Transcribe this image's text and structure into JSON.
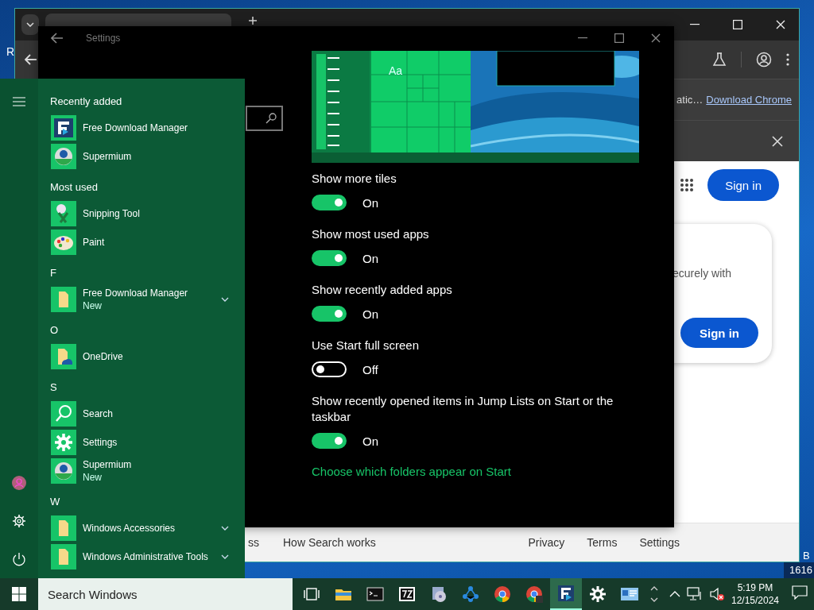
{
  "desktop": {
    "icon_label": "R",
    "corner_texts": [
      "B",
      "1616"
    ]
  },
  "browser": {
    "infobar": {
      "text": "atic…",
      "link": "Download Chrome"
    },
    "page": {
      "header_button": "Sign in",
      "card_text": "ecurely with",
      "card_button": "Sign in"
    },
    "footer": {
      "left": [
        "ss",
        "How Search works"
      ],
      "right": [
        "Privacy",
        "Terms",
        "Settings"
      ]
    }
  },
  "settings": {
    "title": "Settings",
    "preview": {
      "tile_text": "Aa"
    },
    "options": [
      {
        "label": "Show more tiles",
        "on": true,
        "state": "On"
      },
      {
        "label": "Show most used apps",
        "on": true,
        "state": "On"
      },
      {
        "label": "Show recently added apps",
        "on": true,
        "state": "On"
      },
      {
        "label": "Use Start full screen",
        "on": false,
        "state": "Off"
      },
      {
        "label": "Show recently opened items in Jump Lists on Start or the taskbar",
        "on": true,
        "state": "On"
      }
    ],
    "link": "Choose which folders appear on Start"
  },
  "start_menu": {
    "groups": [
      {
        "header": "Recently added",
        "items": [
          {
            "name": "Free Download Manager",
            "kind": "fdm",
            "expandable": false
          },
          {
            "name": "Supermium",
            "kind": "supermium",
            "expandable": false
          }
        ]
      },
      {
        "header": "Most used",
        "items": [
          {
            "name": "Snipping Tool",
            "kind": "snip",
            "expandable": false
          },
          {
            "name": "Paint",
            "kind": "paint",
            "expandable": false
          }
        ]
      },
      {
        "header": "F",
        "items": [
          {
            "name": "Free Download Manager",
            "subtitle": "New",
            "kind": "folder",
            "expandable": true
          }
        ]
      },
      {
        "header": "O",
        "items": [
          {
            "name": "OneDrive",
            "kind": "onedrive",
            "expandable": false
          }
        ]
      },
      {
        "header": "S",
        "items": [
          {
            "name": "Search",
            "kind": "search",
            "expandable": false
          },
          {
            "name": "Settings",
            "kind": "gear",
            "expandable": false
          },
          {
            "name": "Supermium",
            "subtitle": "New",
            "kind": "supermium",
            "expandable": false
          }
        ]
      },
      {
        "header": "W",
        "items": [
          {
            "name": "Windows Accessories",
            "kind": "folder",
            "expandable": true
          },
          {
            "name": "Windows Administrative Tools",
            "kind": "folder",
            "expandable": true
          }
        ]
      }
    ]
  },
  "taskbar": {
    "search_placeholder": "Search Windows",
    "apps": [
      {
        "kind": "task-view",
        "selected": false
      },
      {
        "kind": "explorer",
        "selected": false
      },
      {
        "kind": "terminal",
        "selected": false
      },
      {
        "kind": "archiver",
        "selected": false
      },
      {
        "kind": "installer",
        "selected": false
      },
      {
        "kind": "network",
        "selected": false
      },
      {
        "kind": "chrome",
        "selected": false
      },
      {
        "kind": "chrome-beta",
        "selected": false
      },
      {
        "kind": "fdm",
        "selected": true
      },
      {
        "kind": "gear",
        "selected": false
      },
      {
        "kind": "card",
        "selected": false
      }
    ],
    "time": "5:19 PM",
    "date": "12/15/2024"
  }
}
